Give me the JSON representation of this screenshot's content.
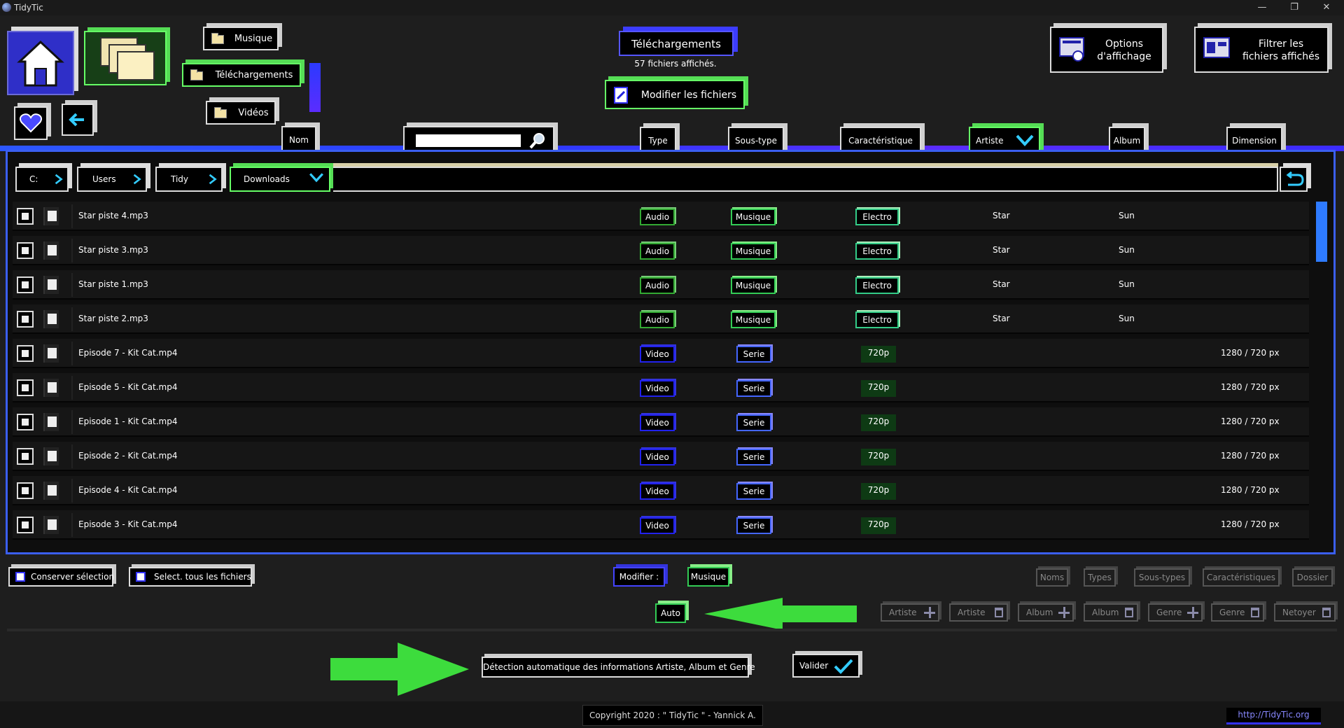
{
  "window": {
    "title": "TidyTic",
    "controls": [
      "—",
      "❐",
      "✕"
    ]
  },
  "nav": {
    "home_icon": "home-icon",
    "shortcuts": {
      "musique": "Musique",
      "telechargements": "Téléchargements",
      "videos": "Vidéos"
    }
  },
  "location": {
    "title": "Téléchargements",
    "count": "57 fichiers affichés.",
    "modify": "Modifier les fichiers"
  },
  "top_right": {
    "options": [
      "Options",
      "d'affichage"
    ],
    "filter": [
      "Filtrer les",
      "fichiers affichés"
    ]
  },
  "columns": {
    "nom": "Nom",
    "type": "Type",
    "soustype": "Sous-type",
    "caracteristique": "Caractéristique",
    "artiste": "Artiste",
    "album": "Album",
    "dimension": "Dimension"
  },
  "breadcrumb": [
    "C:",
    "Users",
    "Tidy",
    "Downloads"
  ],
  "rows": [
    {
      "name": "Star piste 4.mp3",
      "type": "Audio",
      "subtype": "Musique",
      "feature": "Electro",
      "artist": "Star",
      "album": "Sun",
      "dim": ""
    },
    {
      "name": "Star piste 3.mp3",
      "type": "Audio",
      "subtype": "Musique",
      "feature": "Electro",
      "artist": "Star",
      "album": "Sun",
      "dim": ""
    },
    {
      "name": "Star piste 1.mp3",
      "type": "Audio",
      "subtype": "Musique",
      "feature": "Electro",
      "artist": "Star",
      "album": "Sun",
      "dim": ""
    },
    {
      "name": "Star piste 2.mp3",
      "type": "Audio",
      "subtype": "Musique",
      "feature": "Electro",
      "artist": "Star",
      "album": "Sun",
      "dim": ""
    },
    {
      "name": "Episode 7 - Kit Cat.mp4",
      "type": "Video",
      "subtype": "Serie",
      "feature": "720p",
      "artist": "",
      "album": "",
      "dim": "1280 / 720 px"
    },
    {
      "name": "Episode 5 - Kit Cat.mp4",
      "type": "Video",
      "subtype": "Serie",
      "feature": "720p",
      "artist": "",
      "album": "",
      "dim": "1280 / 720 px"
    },
    {
      "name": "Episode 1 - Kit Cat.mp4",
      "type": "Video",
      "subtype": "Serie",
      "feature": "720p",
      "artist": "",
      "album": "",
      "dim": "1280 / 720 px"
    },
    {
      "name": "Episode 2 - Kit Cat.mp4",
      "type": "Video",
      "subtype": "Serie",
      "feature": "720p",
      "artist": "",
      "album": "",
      "dim": "1280 / 720 px"
    },
    {
      "name": "Episode 4 - Kit Cat.mp4",
      "type": "Video",
      "subtype": "Serie",
      "feature": "720p",
      "artist": "",
      "album": "",
      "dim": "1280 / 720 px"
    },
    {
      "name": "Episode 3 - Kit Cat.mp4",
      "type": "Video",
      "subtype": "Serie",
      "feature": "720p",
      "artist": "",
      "album": "",
      "dim": "1280 / 720 px"
    }
  ],
  "bottom": {
    "keep_selection": "Conserver sélection",
    "select_all": "Select. tous les fichiers",
    "modify_label": "Modifier :",
    "modify_value": "Musique",
    "sort_buttons": [
      "Noms",
      "Types",
      "Sous-types",
      "Caractéristiques",
      "Dossier"
    ],
    "auto": "Auto",
    "tag_buttons": [
      "Artiste",
      "Artiste",
      "Album",
      "Album",
      "Genre",
      "Genre",
      "Netoyer"
    ],
    "auto_detect": "Détection automatique des informations Artiste, Album et Genre",
    "validate": "Valider"
  },
  "footer": {
    "copyright": "Copyright 2020 : \" TidyTic \" - Yannick A.",
    "link": "http://TidyTic.org"
  },
  "colors": {
    "accent_blue": "#2c57ff",
    "accent_green": "#55ee55",
    "arrow_green": "#3ddc3d"
  }
}
